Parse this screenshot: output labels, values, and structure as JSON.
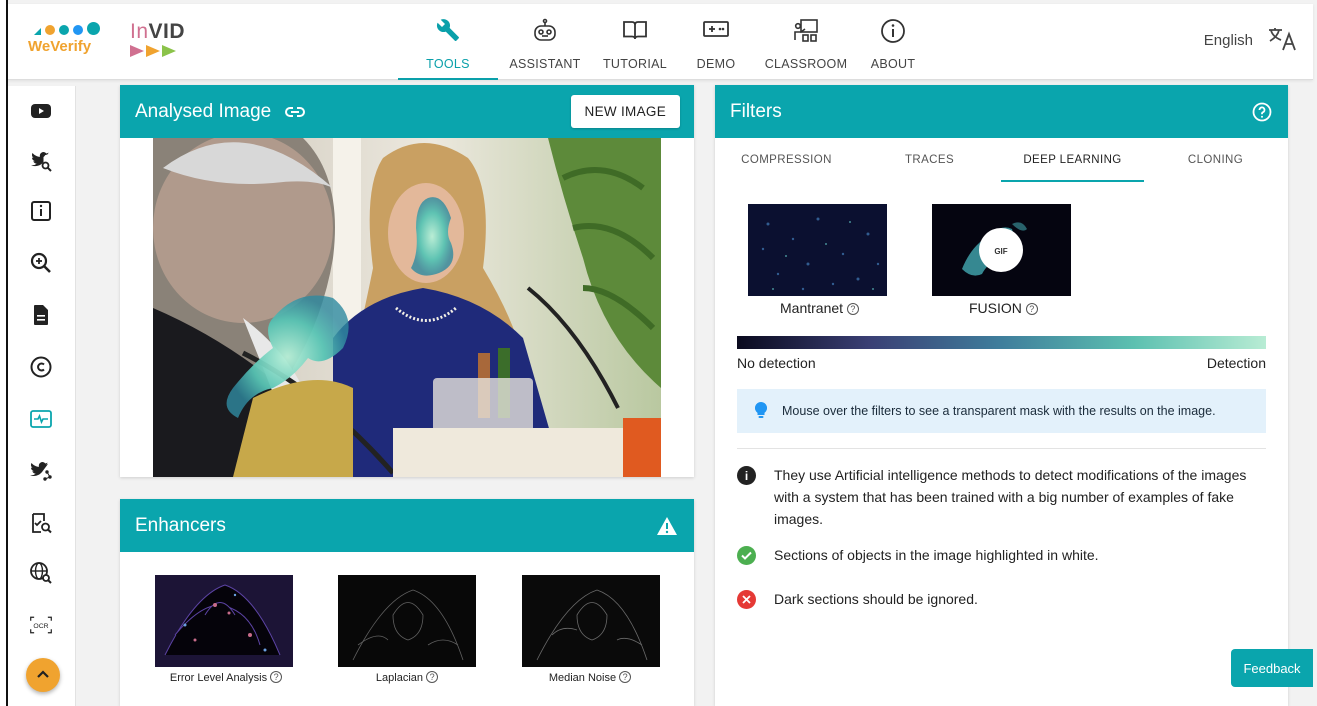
{
  "brand": {
    "weverify": "WeVerify",
    "invid_in": "In",
    "invid_vid": "VID"
  },
  "nav": [
    {
      "label": "TOOLS",
      "icon": "wrench-icon",
      "active": true
    },
    {
      "label": "ASSISTANT",
      "icon": "robot-icon",
      "active": false
    },
    {
      "label": "TUTORIAL",
      "icon": "book-icon",
      "active": false
    },
    {
      "label": "DEMO",
      "icon": "gamepad-icon",
      "active": false
    },
    {
      "label": "CLASSROOM",
      "icon": "classroom-icon",
      "active": false
    },
    {
      "label": "ABOUT",
      "icon": "info-icon",
      "active": false
    }
  ],
  "language": {
    "label": "English",
    "icon": "translate-icon"
  },
  "rail": [
    "video-icon",
    "twitter-search-icon",
    "info-box-icon",
    "magnifier-icon",
    "document-icon",
    "copyright-icon",
    "waveform-icon",
    "twitter-network-icon",
    "verify-search-icon",
    "globe-search-icon",
    "ocr-icon"
  ],
  "analysed": {
    "title": "Analysed Image",
    "new_image": "NEW IMAGE"
  },
  "enhancers": {
    "title": "Enhancers",
    "items": [
      {
        "label": "Error Level Analysis"
      },
      {
        "label": "Laplacian"
      },
      {
        "label": "Median Noise"
      }
    ]
  },
  "filters": {
    "title": "Filters",
    "tabs": [
      "COMPRESSION",
      "TRACES",
      "DEEP LEARNING",
      "CLONING"
    ],
    "active_tab": "DEEP LEARNING",
    "models": [
      {
        "label": "Mantranet"
      },
      {
        "label": "FUSION",
        "badge": "GIF"
      }
    ],
    "scale_left": "No detection",
    "scale_right": "Detection",
    "hint": "Mouse over the filters to see a transparent mask with the results on the image.",
    "info": [
      {
        "type": "info",
        "text": "They use Artificial intelligence methods to detect modifications of the images with a system that has been trained with a big number of examples of fake images."
      },
      {
        "type": "ok",
        "text": "Sections of objects in the image highlighted in white."
      },
      {
        "type": "error",
        "text": "Dark sections should be ignored."
      }
    ]
  },
  "feedback": "Feedback",
  "colors": {
    "accent": "#0aa5ad",
    "orange": "#f0a32f",
    "ok": "#4caf50",
    "error": "#e53935"
  }
}
